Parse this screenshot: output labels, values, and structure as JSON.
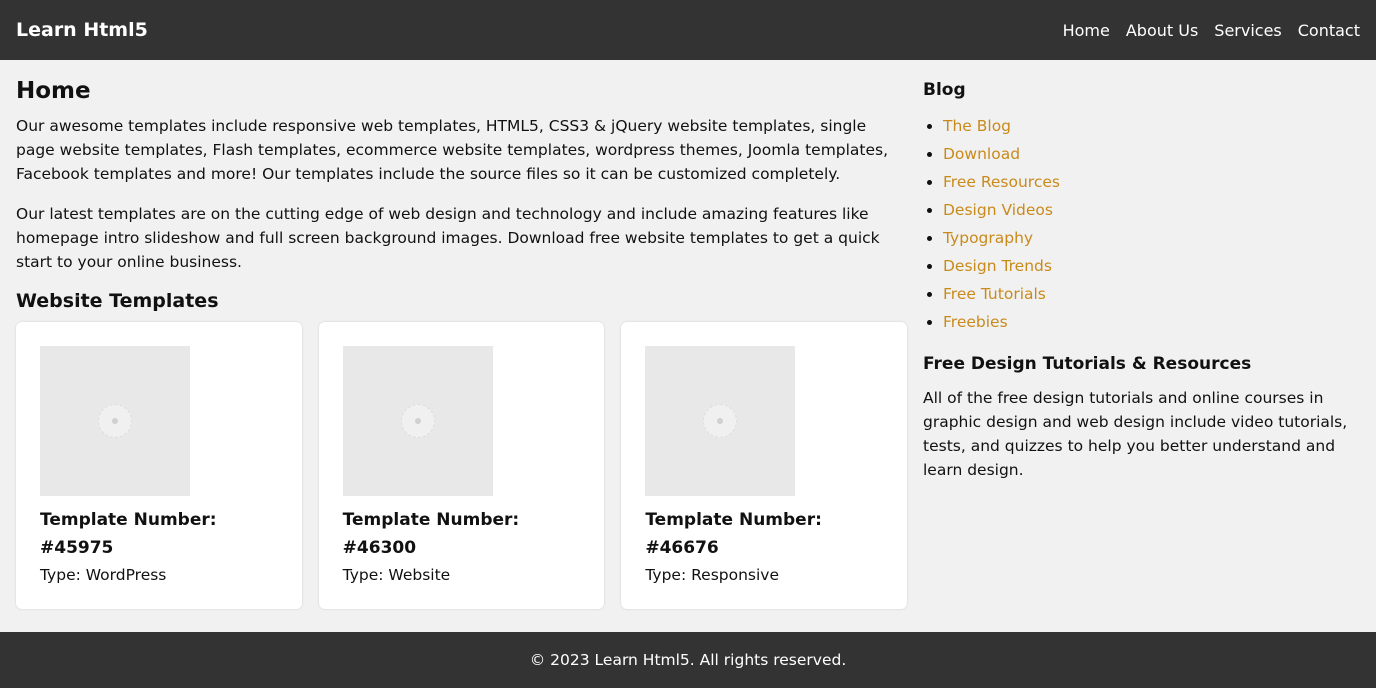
{
  "header": {
    "brand": "Learn Html5",
    "nav": [
      "Home",
      "About Us",
      "Services",
      "Contact"
    ]
  },
  "main": {
    "title": "Home",
    "paragraphs": [
      "Our awesome templates include responsive web templates, HTML5, CSS3 & jQuery website templates, single page website templates, Flash templates, ecommerce website templates, wordpress themes, Joomla templates, Facebook templates and more! Our templates include the source files so it can be customized completely.",
      "Our latest templates are on the cutting edge of web design and technology and include amazing features like homepage intro slideshow and full screen background images. Download free website templates to get a quick start to your online business."
    ],
    "section_title": "Website Templates",
    "cards": [
      {
        "title": "Template Number: #45975",
        "type": "Type: WordPress"
      },
      {
        "title": "Template Number: #46300",
        "type": "Type: Website"
      },
      {
        "title": "Template Number: #46676",
        "type": "Type: Responsive"
      }
    ]
  },
  "sidebar": {
    "blog_title": "Blog",
    "links": [
      "The Blog",
      "Download",
      "Free Resources",
      "Design Videos",
      "Typography",
      "Design Trends",
      "Free Tutorials",
      "Freebies"
    ],
    "tutorials_title": "Free Design Tutorials & Resources",
    "tutorials_text": "All of the free design tutorials and online courses in graphic design and web design include video tutorials, tests, and quizzes to help you better understand and learn design."
  },
  "footer": {
    "text": "© 2023 Learn Html5. All rights reserved."
  },
  "colors": {
    "header_bg": "#333333",
    "link_accent": "#c98a1c",
    "page_bg": "#f1f1f1"
  }
}
